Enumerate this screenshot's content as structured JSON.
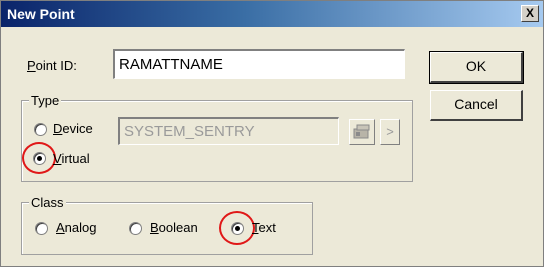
{
  "window": {
    "title": "New Point",
    "close_glyph": "X"
  },
  "point_id": {
    "label_accel": "P",
    "label_rest": "oint ID:",
    "value": "RAMATTNAME"
  },
  "type_group": {
    "legend": "Type",
    "device": {
      "label_accel": "D",
      "label_rest": "evice",
      "checked": false,
      "value": "SYSTEM_SENTRY"
    },
    "virtual": {
      "label_accel": "V",
      "label_rest": "irtual",
      "checked": true
    },
    "browse_icon": "point-browser-icon",
    "next_glyph": ">"
  },
  "class_group": {
    "legend": "Class",
    "analog": {
      "label_accel": "A",
      "label_rest": "nalog",
      "checked": false
    },
    "boolean": {
      "label_accel": "B",
      "label_rest": "oolean",
      "checked": false
    },
    "text": {
      "label_accel": "T",
      "label_rest": "ext",
      "checked": true
    }
  },
  "buttons": {
    "ok": "OK",
    "cancel": "Cancel"
  },
  "colors": {
    "highlight": "#e01818",
    "title_bar": "#0a246a"
  }
}
